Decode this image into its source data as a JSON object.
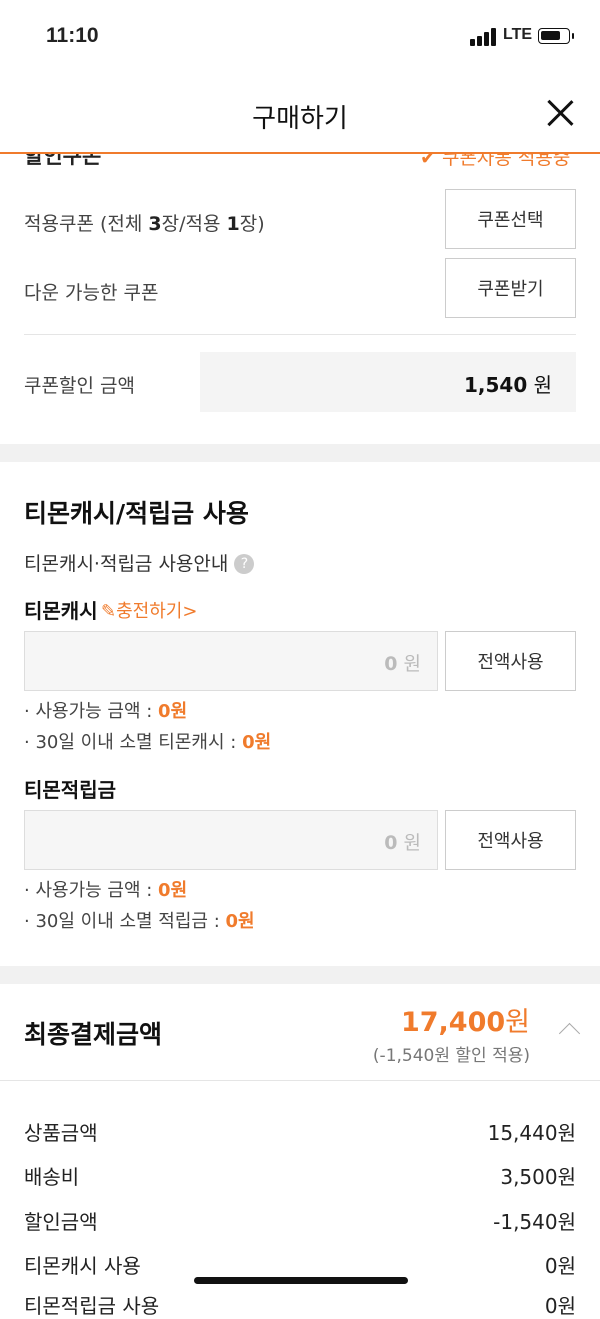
{
  "status_bar": {
    "time": "11:10",
    "network": "LTE"
  },
  "header": {
    "title": "구매하기"
  },
  "coupon": {
    "cut_title": "할인쿠폰",
    "cut_right": "쿠폰자동 적용중",
    "applied_label_prefix": "적용쿠폰 (전체 ",
    "applied_total": "3",
    "applied_mid": "장/적용 ",
    "applied_count": "1",
    "applied_suffix": "장)",
    "select_button": "쿠폰선택",
    "download_label": "다운 가능한 쿠폰",
    "download_button": "쿠폰받기",
    "discount_label": "쿠폰할인 금액",
    "discount_value": "1,540",
    "discount_unit": "원"
  },
  "cash": {
    "section_title": "티몬캐시/적립금 사용",
    "guide_label": "티몬캐시·적립금 사용안내",
    "tmon_cash": {
      "title": "티몬캐시",
      "charge_link": "충전하기>",
      "input_value": "0",
      "input_unit": "원",
      "use_all_button": "전액사용",
      "available_label": "· 사용가능 금액 : ",
      "available_value": "0원",
      "expiring_label": "· 30일 이내 소멸 티몬캐시 : ",
      "expiring_value": "0원"
    },
    "points": {
      "title": "티몬적립금",
      "input_value": "0",
      "input_unit": "원",
      "use_all_button": "전액사용",
      "available_label": "· 사용가능 금액 : ",
      "available_value": "0원",
      "expiring_label": "· 30일 이내 소멸 적립금 : ",
      "expiring_value": "0원"
    }
  },
  "final": {
    "title": "최종결제금액",
    "amount": "17,400",
    "amount_unit": "원",
    "discount_note": "(-1,540원 할인 적용)",
    "rows": [
      {
        "label": "상품금액",
        "value": "15,440원"
      },
      {
        "label": "배송비",
        "value": "3,500원"
      },
      {
        "label": "할인금액",
        "value": "-1,540원"
      },
      {
        "label": "티몬캐시 사용",
        "value": "0원"
      },
      {
        "label": "티몬적립금 사용",
        "value": "0원"
      }
    ]
  },
  "colors": {
    "accent": "#f07b2c",
    "grey_bg": "#f1f1f1"
  },
  "icons": [
    "close-icon",
    "question-icon",
    "pencil-icon",
    "chevron-up-icon",
    "chevron-down-icon"
  ]
}
